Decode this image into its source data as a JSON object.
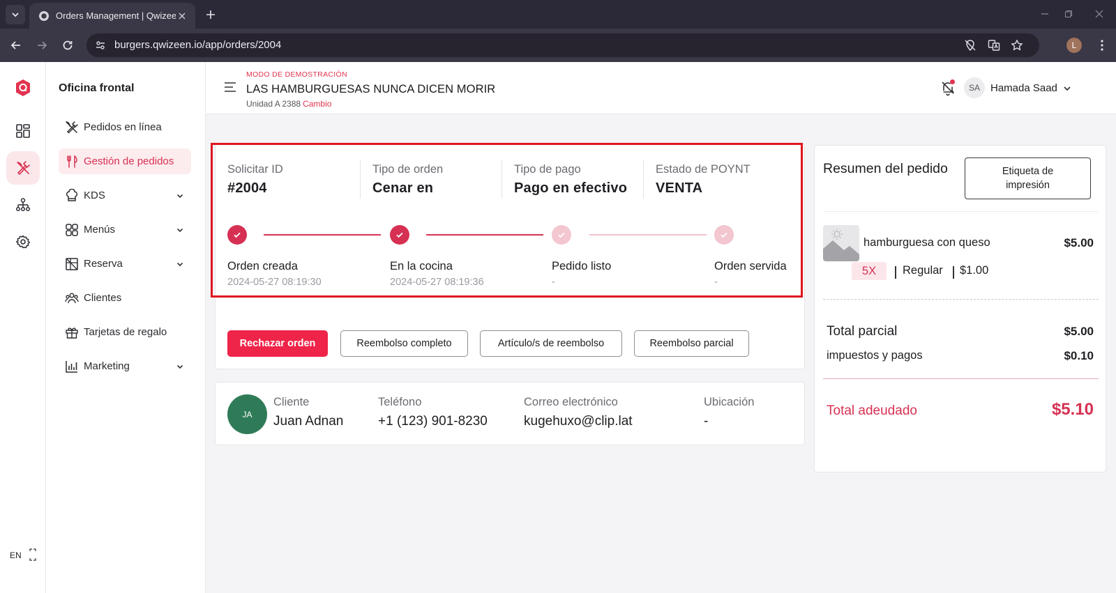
{
  "browser": {
    "tab_title": "Orders Management | Qwizeen",
    "url": "burgers.qwizeen.io/app/orders/2004",
    "profile_initial": "L"
  },
  "rail": {
    "items": [
      {
        "name": "dashboard-icon"
      },
      {
        "name": "utensils-icon"
      },
      {
        "name": "org-chart-icon"
      },
      {
        "name": "gear-icon"
      }
    ],
    "lang": "EN"
  },
  "sidebar": {
    "title": "Oficina frontal",
    "items": [
      {
        "label": "Pedidos en línea",
        "icon": "fork-knife-icon",
        "active": false,
        "chevron": false
      },
      {
        "label": "Gestión de pedidos",
        "icon": "fork-spoon-icon",
        "active": true,
        "chevron": false
      },
      {
        "label": "KDS",
        "icon": "chef-hat-icon",
        "active": false,
        "chevron": true
      },
      {
        "label": "Menús",
        "icon": "grid-icon",
        "active": false,
        "chevron": true
      },
      {
        "label": "Reserva",
        "icon": "table-icon",
        "active": false,
        "chevron": true
      },
      {
        "label": "Clientes",
        "icon": "users-icon",
        "active": false,
        "chevron": false
      },
      {
        "label": "Tarjetas de regalo",
        "icon": "gift-icon",
        "active": false,
        "chevron": false
      },
      {
        "label": "Marketing",
        "icon": "bar-chart-icon",
        "active": false,
        "chevron": true
      }
    ]
  },
  "header": {
    "demo_label": "MODO DE DEMOSTRACIÓN",
    "store_name": "LAS HAMBURGUESAS NUNCA DICEN MORIR",
    "unit": "Unidad A 2388",
    "change": "Cambio",
    "user_initials": "SA",
    "user_name": "Hamada Saad"
  },
  "order": {
    "info": [
      {
        "label": "Solicitar ID",
        "value": "#2004"
      },
      {
        "label": "Tipo de orden",
        "value": "Cenar en"
      },
      {
        "label": "Tipo de pago",
        "value": "Pago en efectivo"
      },
      {
        "label": "Estado de POYNT",
        "value": "VENTA"
      }
    ],
    "steps": [
      {
        "title": "Orden creada",
        "time": "2024-05-27 08:19:30",
        "done": true
      },
      {
        "title": "En la cocina",
        "time": "2024-05-27 08:19:36",
        "done": true
      },
      {
        "title": "Pedido listo",
        "time": "-",
        "done": false
      },
      {
        "title": "Orden servida",
        "time": "-",
        "done": false
      }
    ],
    "actions": {
      "reject": "Rechazar orden",
      "full_refund": "Reembolso completo",
      "item_refund": "Artículo/s de reembolso",
      "partial_refund": "Reembolso parcial"
    }
  },
  "customer": {
    "initials": "JA",
    "fields": [
      {
        "label": "Cliente",
        "value": "Juan Adnan"
      },
      {
        "label": "Teléfono",
        "value": "+1 (123) 901-8230"
      },
      {
        "label": "Correo electrónico",
        "value": "kugehuxo@clip.lat"
      },
      {
        "label": "Ubicación",
        "value": "-"
      }
    ]
  },
  "summary": {
    "title": "Resumen del pedido",
    "print_label": "Etiqueta de impresión",
    "item": {
      "name": "hamburguesa con queso",
      "price": "$5.00",
      "qty": "5X",
      "variant": "Regular",
      "variant_price": "$1.00"
    },
    "subtotal_label": "Total parcial",
    "subtotal": "$5.00",
    "taxes_label": "impuestos y pagos",
    "taxes": "$0.10",
    "due_label": "Total adeudado",
    "due": "$5.10"
  },
  "colors": {
    "accent": "#d63152",
    "primary_button": "#ef2449",
    "highlight_box": "#e0151f",
    "customer_avatar": "#2f7b58"
  }
}
